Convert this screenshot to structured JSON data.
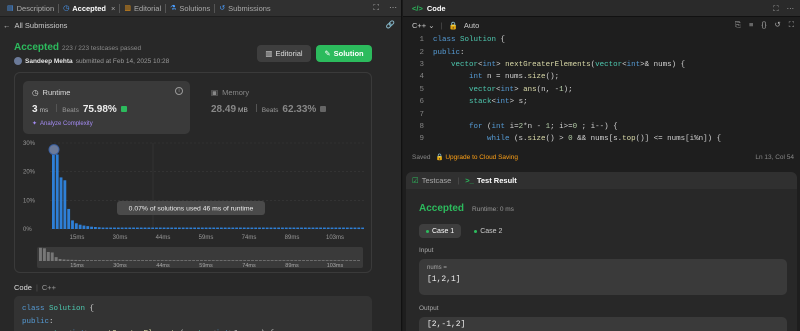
{
  "tabs": [
    {
      "icon": "document-icon",
      "label": "Description",
      "active": false
    },
    {
      "icon": "clock-icon",
      "label": "Accepted",
      "active": true
    },
    {
      "icon": "book-icon",
      "label": "Editorial",
      "active": false
    },
    {
      "icon": "flask-icon",
      "label": "Solutions",
      "active": false
    },
    {
      "icon": "history-icon",
      "label": "Submissions",
      "active": false
    }
  ],
  "tab_close": "×",
  "back_label": "All Submissions",
  "result": {
    "status": "Accepted",
    "passed": "223 / 223 testcases passed",
    "user": "Sandeep Mehta",
    "submitted": "submitted at Feb 14, 2025 10:28"
  },
  "buttons": {
    "editorial": "Editorial",
    "solution": "Solution"
  },
  "runtime": {
    "title": "Runtime",
    "value": "3",
    "unit": "ms",
    "beats_label": "Beats",
    "beats": "75.98%",
    "analyze": "Analyze Complexity"
  },
  "memory": {
    "title": "Memory",
    "value": "28.49",
    "unit": "MB",
    "beats_label": "Beats",
    "beats": "62.33%"
  },
  "chart_data": {
    "type": "bar",
    "ylabel": "",
    "yticks": [
      "30%",
      "20%",
      "10%",
      "0%"
    ],
    "ylim": [
      0,
      30
    ],
    "xticks": [
      "15ms",
      "30ms",
      "44ms",
      "59ms",
      "74ms",
      "89ms",
      "103ms"
    ],
    "values": [
      27,
      26,
      18,
      17,
      7,
      3,
      2,
      1.5,
      1.2,
      1,
      0.8,
      0.7,
      0.6,
      0.5,
      0.5,
      0.5,
      0.5,
      0.5,
      0.5,
      0.5,
      0.5,
      0.5,
      0.5,
      0.5,
      0.5,
      0.5,
      0.5,
      0.5,
      0.5,
      0.5,
      0.5,
      0.5,
      0.5,
      0.5,
      0.5,
      0.5,
      0.5,
      0.5,
      0.5,
      0.5,
      0.5,
      0.5,
      0.5,
      0.5,
      0.5,
      0.5,
      0.5,
      0.5,
      0.5,
      0.5,
      0.5,
      0.5,
      0.5,
      0.5,
      0.5,
      0.5,
      0.5,
      0.5,
      0.5,
      0.5,
      0.5,
      0.5,
      0.5,
      0.5,
      0.5,
      0.5,
      0.5,
      0.5,
      0.5,
      0.5,
      0.5,
      0.5,
      0.5,
      0.5,
      0.5,
      0.5,
      0.5,
      0.5,
      0.5,
      0.5,
      0.5,
      0.5
    ],
    "tooltip": "0.07% of solutions used 46 ms of runtime",
    "overview_ticks": [
      "15ms",
      "30ms",
      "44ms",
      "59ms",
      "74ms",
      "89ms",
      "103ms"
    ],
    "bar_color": "#2e7fd6"
  },
  "left_code": {
    "label": "Code",
    "lang": "C++",
    "lines": [
      [
        {
          "c": "kw",
          "t": "class "
        },
        {
          "c": "ty",
          "t": "Solution"
        },
        {
          "c": "tx",
          "t": " {"
        }
      ],
      [
        {
          "c": "kw",
          "t": "public"
        },
        {
          "c": "tx",
          "t": ":"
        }
      ],
      [
        {
          "c": "tx",
          "t": "    "
        },
        {
          "c": "ty",
          "t": "vector"
        },
        {
          "c": "tx",
          "t": "<"
        },
        {
          "c": "kw",
          "t": "int"
        },
        {
          "c": "tx",
          "t": "> "
        },
        {
          "c": "fn",
          "t": "nextGreaterElements"
        },
        {
          "c": "tx",
          "t": "("
        },
        {
          "c": "ty",
          "t": "vector"
        },
        {
          "c": "tx",
          "t": "<"
        },
        {
          "c": "kw",
          "t": "int"
        },
        {
          "c": "tx",
          "t": ">& nums) {"
        }
      ]
    ]
  },
  "editor": {
    "title": "Code",
    "language": "C++",
    "autosave": "Auto",
    "lines": [
      [
        {
          "c": "kw",
          "t": "class "
        },
        {
          "c": "ty",
          "t": "Solution"
        },
        {
          "c": "tx",
          "t": " {"
        }
      ],
      [
        {
          "c": "kw",
          "t": "public"
        },
        {
          "c": "tx",
          "t": ":"
        }
      ],
      [
        {
          "c": "tx",
          "t": "    "
        },
        {
          "c": "ty",
          "t": "vector"
        },
        {
          "c": "tx",
          "t": "<"
        },
        {
          "c": "kw",
          "t": "int"
        },
        {
          "c": "tx",
          "t": "> "
        },
        {
          "c": "fn",
          "t": "nextGreaterElements"
        },
        {
          "c": "tx",
          "t": "("
        },
        {
          "c": "ty",
          "t": "vector"
        },
        {
          "c": "tx",
          "t": "<"
        },
        {
          "c": "kw",
          "t": "int"
        },
        {
          "c": "tx",
          "t": ">& nums) {"
        }
      ],
      [
        {
          "c": "tx",
          "t": "        "
        },
        {
          "c": "kw",
          "t": "int"
        },
        {
          "c": "tx",
          "t": " n = nums."
        },
        {
          "c": "fn",
          "t": "size"
        },
        {
          "c": "tx",
          "t": "();"
        }
      ],
      [
        {
          "c": "tx",
          "t": "        "
        },
        {
          "c": "ty",
          "t": "vector"
        },
        {
          "c": "tx",
          "t": "<"
        },
        {
          "c": "kw",
          "t": "int"
        },
        {
          "c": "tx",
          "t": "> "
        },
        {
          "c": "fn",
          "t": "ans"
        },
        {
          "c": "tx",
          "t": "(n, -"
        },
        {
          "c": "nm",
          "t": "1"
        },
        {
          "c": "tx",
          "t": ");"
        }
      ],
      [
        {
          "c": "tx",
          "t": "        "
        },
        {
          "c": "ty",
          "t": "stack"
        },
        {
          "c": "tx",
          "t": "<"
        },
        {
          "c": "kw",
          "t": "int"
        },
        {
          "c": "tx",
          "t": "> s;"
        }
      ],
      [
        {
          "c": "tx",
          "t": ""
        }
      ],
      [
        {
          "c": "tx",
          "t": "        "
        },
        {
          "c": "kw",
          "t": "for"
        },
        {
          "c": "tx",
          "t": " ("
        },
        {
          "c": "kw",
          "t": "int"
        },
        {
          "c": "tx",
          "t": " i="
        },
        {
          "c": "nm",
          "t": "2"
        },
        {
          "c": "tx",
          "t": "*n - "
        },
        {
          "c": "nm",
          "t": "1"
        },
        {
          "c": "tx",
          "t": "; i>="
        },
        {
          "c": "nm",
          "t": "0"
        },
        {
          "c": "tx",
          "t": " ; i--) {"
        }
      ],
      [
        {
          "c": "tx",
          "t": "            "
        },
        {
          "c": "kw",
          "t": "while"
        },
        {
          "c": "tx",
          "t": " (s."
        },
        {
          "c": "fn",
          "t": "size"
        },
        {
          "c": "tx",
          "t": "() > "
        },
        {
          "c": "nm",
          "t": "0"
        },
        {
          "c": "tx",
          "t": " && nums[s."
        },
        {
          "c": "fn",
          "t": "top"
        },
        {
          "c": "tx",
          "t": "()] <= nums[i%n]) {"
        }
      ]
    ],
    "saved": "Saved",
    "upgrade": "Upgrade to Cloud Saving",
    "position": "Ln 13, Col 54"
  },
  "testcase": {
    "tab_testcase": "Testcase",
    "tab_result": "Test Result",
    "status": "Accepted",
    "runtime": "Runtime: 0 ms",
    "cases": [
      "Case 1",
      "Case 2"
    ],
    "input_label": "Input",
    "var_name": "nums =",
    "input_value": "[1,2,1]",
    "output_label": "Output",
    "output_value": "[2,-1,2]"
  }
}
